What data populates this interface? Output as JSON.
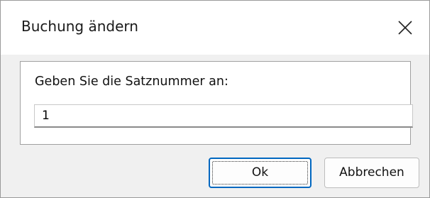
{
  "dialog": {
    "title": "Buchung ändern",
    "close_icon": "close-icon"
  },
  "content": {
    "prompt": "Geben Sie die Satznummer an:",
    "record_number_value": "1"
  },
  "buttons": {
    "ok_label": "Ok",
    "cancel_label": "Abbrechen"
  },
  "colors": {
    "accent": "#0067c0",
    "window_bg": "#f0f0f0",
    "panel_bg": "#ffffff"
  }
}
